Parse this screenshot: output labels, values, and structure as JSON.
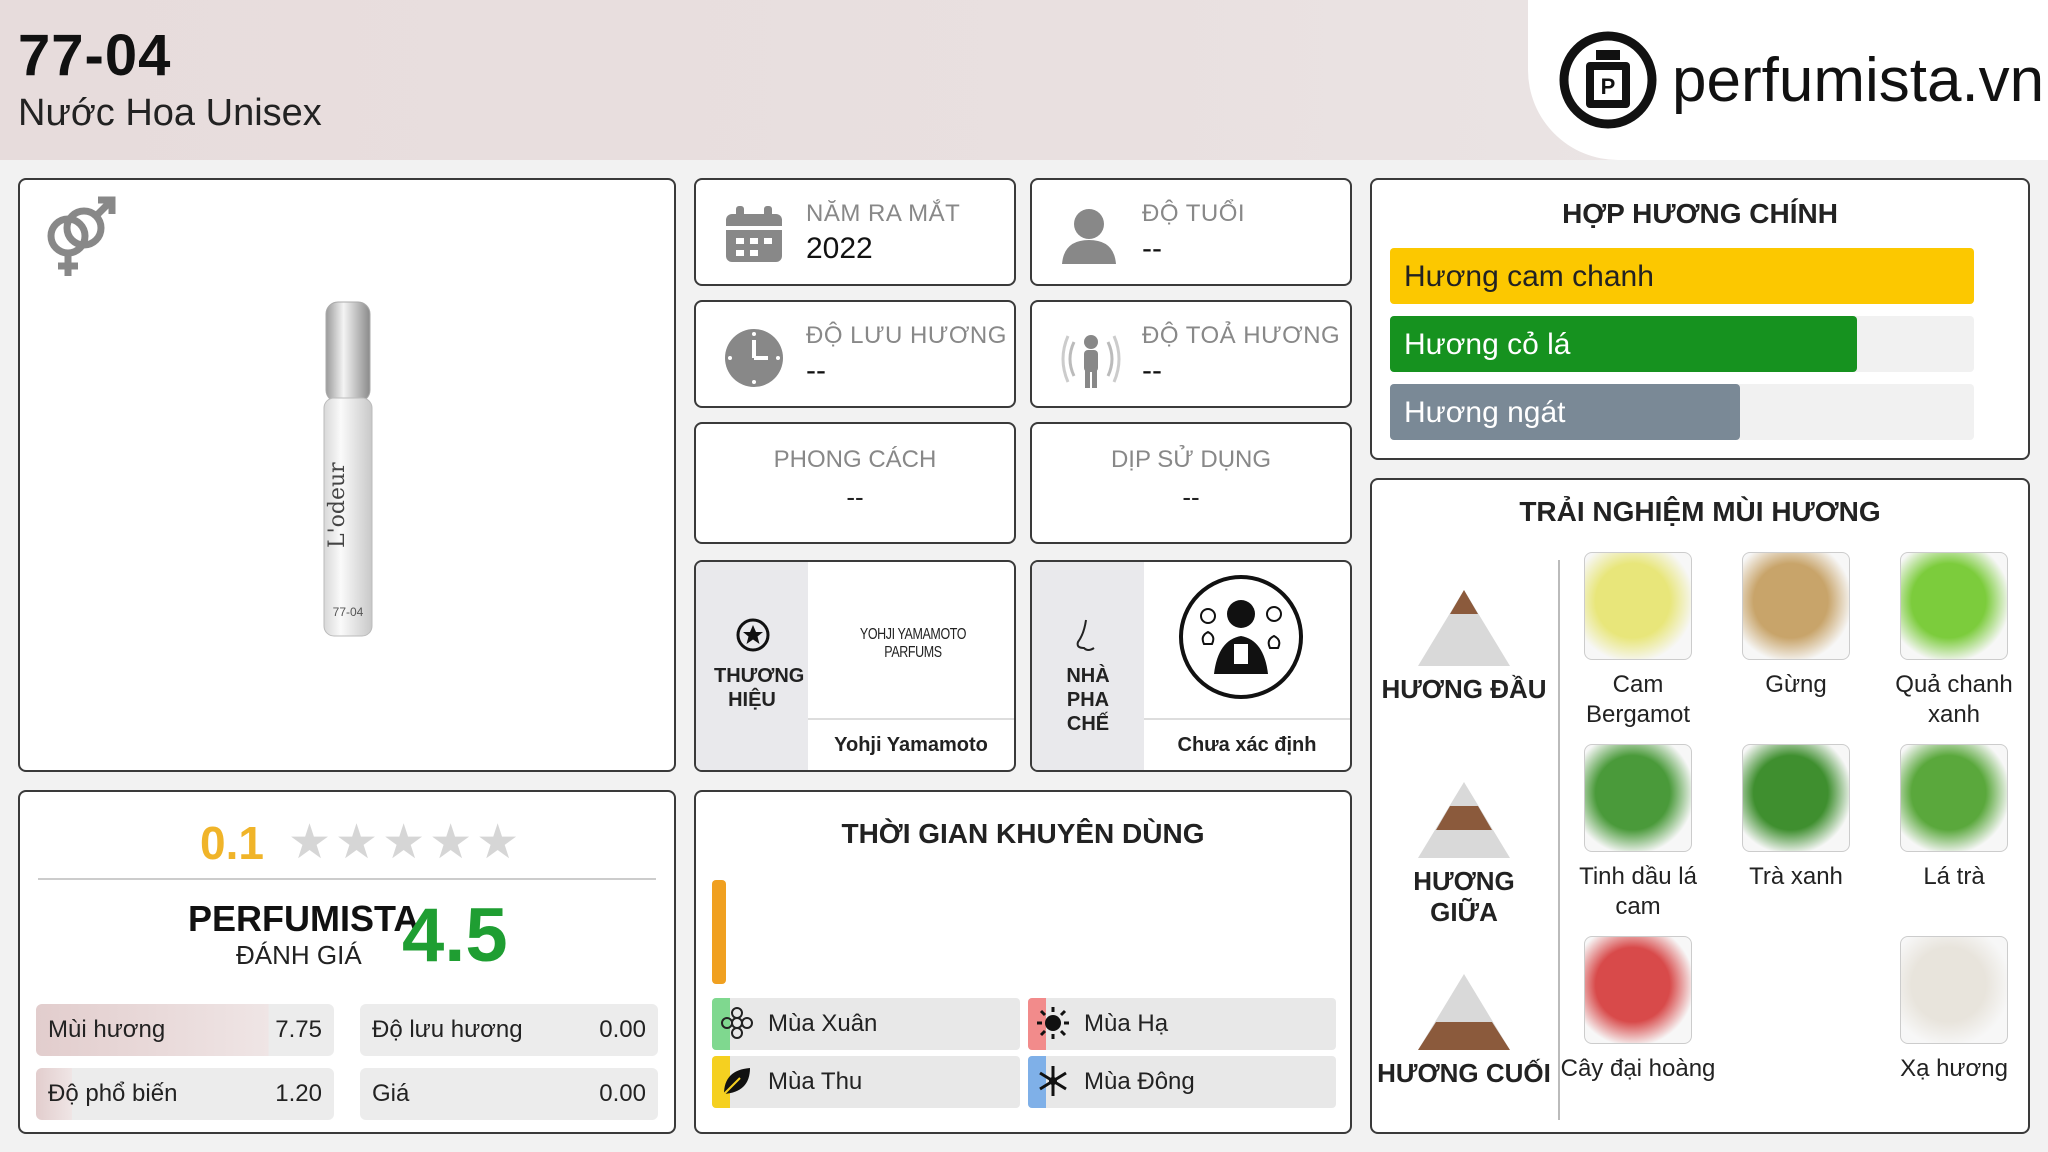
{
  "header": {
    "title": "77-04",
    "subtitle": "Nước Hoa Unisex",
    "logo_text": "perfumista.vn"
  },
  "product": {
    "bottle_label": "L'odeur",
    "bottle_code": "77-04"
  },
  "info": {
    "release_year": {
      "label": "NĂM RA MẮT",
      "value": "2022"
    },
    "age": {
      "label": "ĐỘ TUỔI",
      "value": "--"
    },
    "longevity": {
      "label": "ĐỘ LƯU HƯƠNG",
      "value": "--"
    },
    "sillage": {
      "label": "ĐỘ TOẢ HƯƠNG",
      "value": "--"
    },
    "style": {
      "label": "PHONG CÁCH",
      "value": "--"
    },
    "occasion": {
      "label": "DỊP SỬ DỤNG",
      "value": "--"
    }
  },
  "brand": {
    "label": "THƯƠNG HIỆU",
    "logo_text": "YOHJI YAMAMOTO PARFUMS",
    "name": "Yohji Yamamoto"
  },
  "perfumer": {
    "label": "NHÀ PHA CHẾ",
    "name": "Chưa xác định"
  },
  "accords": {
    "title": "HỢP HƯƠNG CHÍNH",
    "items": [
      {
        "label": "Hương cam chanh",
        "fraction": 1.0,
        "color": "#fcc800",
        "text_color": "#222222"
      },
      {
        "label": "Hương cỏ lá",
        "fraction": 0.8,
        "color": "#16921f",
        "text_color": "#ffffff"
      },
      {
        "label": "Hương ngát",
        "fraction": 0.6,
        "color": "#7a8996",
        "text_color": "#ffffff"
      }
    ]
  },
  "rating": {
    "user_score": "0.1",
    "stars_total": 5,
    "perfumista_label": "PERFUMISTA",
    "perfumista_sub": "ĐÁNH GIÁ",
    "perfumista_score": "4.5",
    "metrics": [
      {
        "label": "Mùi hương",
        "value": "7.75",
        "fill": 0.775
      },
      {
        "label": "Độ lưu hương",
        "value": "0.00",
        "fill": 0.0
      },
      {
        "label": "Độ phổ biến",
        "value": "1.20",
        "fill": 0.12
      },
      {
        "label": "Giá",
        "value": "0.00",
        "fill": 0.0
      }
    ]
  },
  "seasons": {
    "title": "THỜI GIAN KHUYÊN DÙNG",
    "items": [
      {
        "label": "Mùa Xuân",
        "icon": "flower-icon",
        "color": "#7fd88f"
      },
      {
        "label": "Mùa Hạ",
        "icon": "sun-icon",
        "color": "#f28b8b"
      },
      {
        "label": "Mùa Thu",
        "icon": "leaf-icon",
        "color": "#f5d020"
      },
      {
        "label": "Mùa Đông",
        "icon": "snowflake-icon",
        "color": "#7fb0e8"
      }
    ]
  },
  "notes": {
    "title": "TRẢI NGHIỆM MÙI HƯƠNG",
    "top": {
      "label": "HƯƠNG ĐẦU",
      "items": [
        "Cam Bergamot",
        "Gừng",
        "Quả chanh xanh"
      ]
    },
    "middle": {
      "label": "HƯƠNG GIỮA",
      "items": [
        "Tinh dầu lá cam",
        "Trà xanh",
        "Lá trà"
      ]
    },
    "base": {
      "label": "HƯƠNG CUỐI",
      "items": [
        "Cây đại hoàng",
        "Xạ hương"
      ]
    }
  }
}
